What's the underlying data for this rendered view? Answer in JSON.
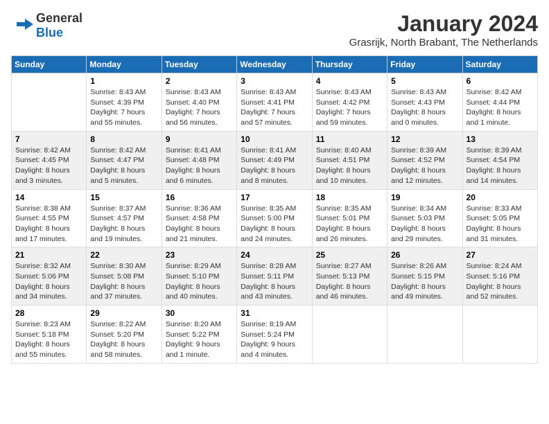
{
  "header": {
    "logo": {
      "general": "General",
      "blue": "Blue"
    },
    "title": "January 2024",
    "location": "Grasrijk, North Brabant, The Netherlands"
  },
  "calendar": {
    "headers": [
      "Sunday",
      "Monday",
      "Tuesday",
      "Wednesday",
      "Thursday",
      "Friday",
      "Saturday"
    ],
    "weeks": [
      {
        "days": [
          {
            "number": "",
            "info": ""
          },
          {
            "number": "1",
            "info": "Sunrise: 8:43 AM\nSunset: 4:39 PM\nDaylight: 7 hours\nand 55 minutes."
          },
          {
            "number": "2",
            "info": "Sunrise: 8:43 AM\nSunset: 4:40 PM\nDaylight: 7 hours\nand 56 minutes."
          },
          {
            "number": "3",
            "info": "Sunrise: 8:43 AM\nSunset: 4:41 PM\nDaylight: 7 hours\nand 57 minutes."
          },
          {
            "number": "4",
            "info": "Sunrise: 8:43 AM\nSunset: 4:42 PM\nDaylight: 7 hours\nand 59 minutes."
          },
          {
            "number": "5",
            "info": "Sunrise: 8:43 AM\nSunset: 4:43 PM\nDaylight: 8 hours\nand 0 minutes."
          },
          {
            "number": "6",
            "info": "Sunrise: 8:42 AM\nSunset: 4:44 PM\nDaylight: 8 hours\nand 1 minute."
          }
        ]
      },
      {
        "days": [
          {
            "number": "7",
            "info": "Sunrise: 8:42 AM\nSunset: 4:45 PM\nDaylight: 8 hours\nand 3 minutes."
          },
          {
            "number": "8",
            "info": "Sunrise: 8:42 AM\nSunset: 4:47 PM\nDaylight: 8 hours\nand 5 minutes."
          },
          {
            "number": "9",
            "info": "Sunrise: 8:41 AM\nSunset: 4:48 PM\nDaylight: 8 hours\nand 6 minutes."
          },
          {
            "number": "10",
            "info": "Sunrise: 8:41 AM\nSunset: 4:49 PM\nDaylight: 8 hours\nand 8 minutes."
          },
          {
            "number": "11",
            "info": "Sunrise: 8:40 AM\nSunset: 4:51 PM\nDaylight: 8 hours\nand 10 minutes."
          },
          {
            "number": "12",
            "info": "Sunrise: 8:39 AM\nSunset: 4:52 PM\nDaylight: 8 hours\nand 12 minutes."
          },
          {
            "number": "13",
            "info": "Sunrise: 8:39 AM\nSunset: 4:54 PM\nDaylight: 8 hours\nand 14 minutes."
          }
        ]
      },
      {
        "days": [
          {
            "number": "14",
            "info": "Sunrise: 8:38 AM\nSunset: 4:55 PM\nDaylight: 8 hours\nand 17 minutes."
          },
          {
            "number": "15",
            "info": "Sunrise: 8:37 AM\nSunset: 4:57 PM\nDaylight: 8 hours\nand 19 minutes."
          },
          {
            "number": "16",
            "info": "Sunrise: 8:36 AM\nSunset: 4:58 PM\nDaylight: 8 hours\nand 21 minutes."
          },
          {
            "number": "17",
            "info": "Sunrise: 8:35 AM\nSunset: 5:00 PM\nDaylight: 8 hours\nand 24 minutes."
          },
          {
            "number": "18",
            "info": "Sunrise: 8:35 AM\nSunset: 5:01 PM\nDaylight: 8 hours\nand 26 minutes."
          },
          {
            "number": "19",
            "info": "Sunrise: 8:34 AM\nSunset: 5:03 PM\nDaylight: 8 hours\nand 29 minutes."
          },
          {
            "number": "20",
            "info": "Sunrise: 8:33 AM\nSunset: 5:05 PM\nDaylight: 8 hours\nand 31 minutes."
          }
        ]
      },
      {
        "days": [
          {
            "number": "21",
            "info": "Sunrise: 8:32 AM\nSunset: 5:06 PM\nDaylight: 8 hours\nand 34 minutes."
          },
          {
            "number": "22",
            "info": "Sunrise: 8:30 AM\nSunset: 5:08 PM\nDaylight: 8 hours\nand 37 minutes."
          },
          {
            "number": "23",
            "info": "Sunrise: 8:29 AM\nSunset: 5:10 PM\nDaylight: 8 hours\nand 40 minutes."
          },
          {
            "number": "24",
            "info": "Sunrise: 8:28 AM\nSunset: 5:11 PM\nDaylight: 8 hours\nand 43 minutes."
          },
          {
            "number": "25",
            "info": "Sunrise: 8:27 AM\nSunset: 5:13 PM\nDaylight: 8 hours\nand 46 minutes."
          },
          {
            "number": "26",
            "info": "Sunrise: 8:26 AM\nSunset: 5:15 PM\nDaylight: 8 hours\nand 49 minutes."
          },
          {
            "number": "27",
            "info": "Sunrise: 8:24 AM\nSunset: 5:16 PM\nDaylight: 8 hours\nand 52 minutes."
          }
        ]
      },
      {
        "days": [
          {
            "number": "28",
            "info": "Sunrise: 8:23 AM\nSunset: 5:18 PM\nDaylight: 8 hours\nand 55 minutes."
          },
          {
            "number": "29",
            "info": "Sunrise: 8:22 AM\nSunset: 5:20 PM\nDaylight: 8 hours\nand 58 minutes."
          },
          {
            "number": "30",
            "info": "Sunrise: 8:20 AM\nSunset: 5:22 PM\nDaylight: 9 hours\nand 1 minute."
          },
          {
            "number": "31",
            "info": "Sunrise: 8:19 AM\nSunset: 5:24 PM\nDaylight: 9 hours\nand 4 minutes."
          },
          {
            "number": "",
            "info": ""
          },
          {
            "number": "",
            "info": ""
          },
          {
            "number": "",
            "info": ""
          }
        ]
      }
    ]
  }
}
